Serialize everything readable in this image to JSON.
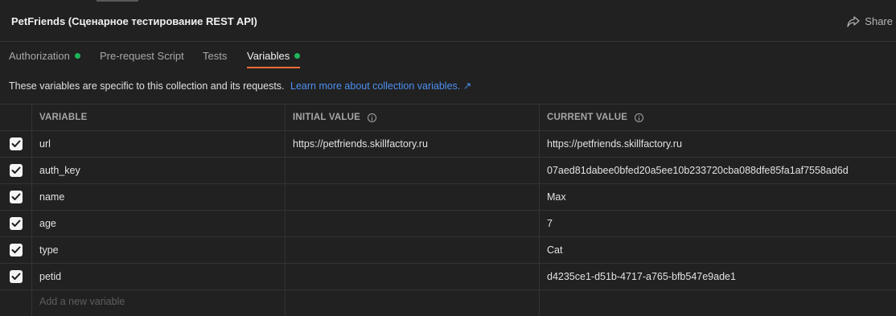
{
  "header": {
    "title": "PetFriends (Сценарное тестирование REST API)",
    "share_label": "Share"
  },
  "tabs": [
    {
      "label": "Authorization",
      "status": "green-dot"
    },
    {
      "label": "Pre-request Script"
    },
    {
      "label": "Tests"
    },
    {
      "label": "Variables",
      "status": "green-dot",
      "active": true
    }
  ],
  "description": {
    "text": "These variables are specific to this collection and its requests.",
    "link": "Learn more about collection variables. ↗"
  },
  "table": {
    "columns": [
      "VARIABLE",
      "INITIAL VALUE",
      "CURRENT VALUE"
    ],
    "rows": [
      {
        "variable": "url",
        "initial": "https://petfriends.skillfactory.ru",
        "current": "https://petfriends.skillfactory.ru",
        "checked": true
      },
      {
        "variable": "auth_key",
        "initial": "",
        "current": "07aed81dabee0bfed20a5ee10b233720cba088dfe85fa1af7558ad6d",
        "checked": true
      },
      {
        "variable": "name",
        "initial": "",
        "current": "Max",
        "checked": true
      },
      {
        "variable": "age",
        "initial": "",
        "current": "7",
        "checked": true
      },
      {
        "variable": "type",
        "initial": "",
        "current": "Cat",
        "checked": true
      },
      {
        "variable": "petid",
        "initial": "",
        "current": "d4235ce1-d51b-4717-a765-bfb547e9ade1",
        "checked": true
      }
    ],
    "add_placeholder": "Add a new variable"
  },
  "colors": {
    "background": "#212121",
    "accent": "#ff6c37",
    "status_green": "#1fb55a",
    "link": "#4c8ff0"
  }
}
